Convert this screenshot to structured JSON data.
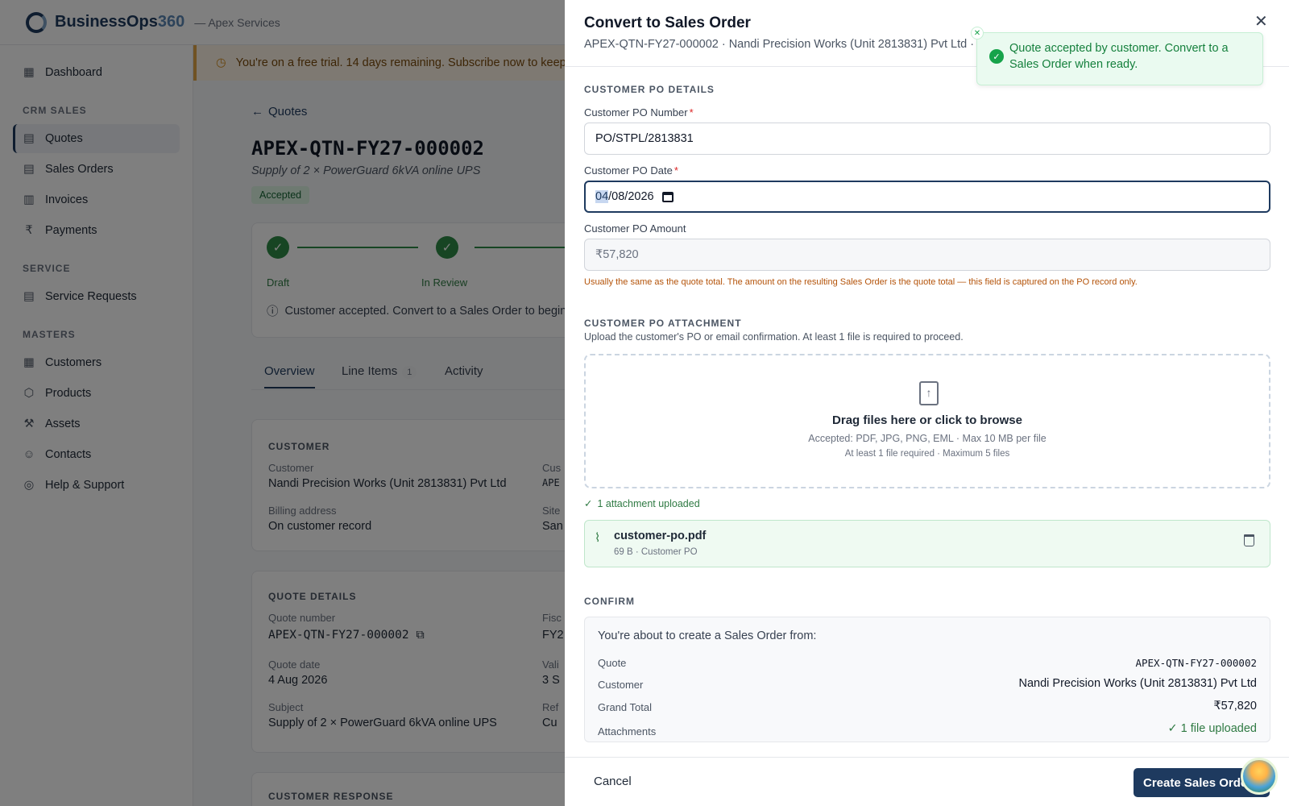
{
  "app": {
    "brand_main": "BusinessOps",
    "brand_accent": "360",
    "org": "— Apex Services"
  },
  "sidebar": {
    "items": [
      {
        "label": "Dashboard",
        "icon": "grid-icon"
      },
      {
        "section": "CRM SALES"
      },
      {
        "label": "Quotes",
        "icon": "document-icon",
        "active": true
      },
      {
        "label": "Sales Orders",
        "icon": "document-icon"
      },
      {
        "label": "Invoices",
        "icon": "receipt-icon"
      },
      {
        "label": "Payments",
        "icon": "rupee-icon"
      },
      {
        "section": "SERVICE"
      },
      {
        "label": "Service Requests",
        "icon": "clipboard-icon"
      },
      {
        "section": "MASTERS"
      },
      {
        "label": "Customers",
        "icon": "building-icon"
      },
      {
        "label": "Products",
        "icon": "box-icon"
      },
      {
        "label": "Assets",
        "icon": "wrench-icon"
      },
      {
        "label": "Contacts",
        "icon": "user-icon"
      },
      {
        "label": "Help & Support",
        "icon": "lifebuoy-icon"
      }
    ]
  },
  "trial": {
    "text": "You're on a free trial. 14 days remaining. Subscribe now to keep"
  },
  "quote": {
    "back": "Quotes",
    "number": "APEX-QTN-FY27-000002",
    "subject": "Supply of 2 × PowerGuard 6kVA online UPS",
    "status": "Accepted",
    "steps": [
      "Draft",
      "In Review"
    ],
    "info": "Customer accepted. Convert to a Sales Order to begin",
    "tabs": {
      "overview": "Overview",
      "line_items": "Line Items",
      "line_items_count": "1",
      "activity": "Activity"
    },
    "customer_card": {
      "title": "CUSTOMER",
      "customer_label": "Customer",
      "customer_value": "Nandi Precision Works (Unit 2813831) Pvt Ltd",
      "billing_label": "Billing address",
      "billing_value": "On customer record",
      "col2_label_1": "Cus",
      "col2_value_1": "APE",
      "col2_label_2": "Site",
      "col2_value_2": "San"
    },
    "details_card": {
      "title": "QUOTE DETAILS",
      "number_label": "Quote number",
      "number_value": "APEX-QTN-FY27-000002",
      "date_label": "Quote date",
      "date_value": "4 Aug 2026",
      "subject_label": "Subject",
      "subject_value": "Supply of 2 × PowerGuard 6kVA online UPS",
      "col2_label_1": "Fisc",
      "col2_value_1": "FY2",
      "col2_label_2": "Vali",
      "col2_value_2": "3 S",
      "col2_label_3": "Ref",
      "col2_value_3": "Cu"
    },
    "response_title": "CUSTOMER RESPONSE"
  },
  "drawer": {
    "title": "Convert to Sales Order",
    "subtitle": "APEX-QTN-FY27-000002 · Nandi Precision Works (Unit 2813831) Pvt Ltd ·",
    "po_section": "CUSTOMER PO DETAILS",
    "po_number_label": "Customer PO Number",
    "po_number_value": "PO/STPL/2813831",
    "po_date_label": "Customer PO Date",
    "po_date_month": "04",
    "po_date_rest": "/08/2026",
    "po_amount_label": "Customer PO Amount",
    "po_amount_placeholder": "₹57,820",
    "po_amount_hint": "Usually the same as the quote total. The amount on the resulting Sales Order is the quote total — this field is captured on the PO record only.",
    "attach_section": "CUSTOMER PO ATTACHMENT",
    "attach_desc": "Upload the customer's PO or email confirmation. At least 1 file is required to proceed.",
    "dropzone_main": "Drag files here or click to browse",
    "dropzone_accepted": "Accepted: PDF, JPG, PNG, EML · Max 10 MB per file",
    "dropzone_limits": "At least 1 file required · Maximum 5 files",
    "uploaded_status": "1 attachment uploaded",
    "file_name": "customer-po.pdf",
    "file_meta": "69 B · Customer PO",
    "confirm_section": "CONFIRM",
    "confirm_intro": "You're about to create a Sales Order from:",
    "confirm_rows": [
      {
        "key": "Quote",
        "value": "APEX-QTN-FY27-000002"
      },
      {
        "key": "Customer",
        "value": "Nandi Precision Works (Unit 2813831) Pvt Ltd"
      },
      {
        "key": "Grand Total",
        "value": "₹57,820"
      },
      {
        "key": "Attachments",
        "value": "1 file uploaded"
      }
    ],
    "cancel": "Cancel",
    "submit": "Create Sales Order"
  },
  "toast": {
    "text": "Quote accepted by customer. Convert to a Sales Order when ready."
  },
  "colors": {
    "brand": "#1e3a5f",
    "success": "#2f8a47",
    "warning": "#b45309",
    "overlay": "rgba(0,0,0,0.5)"
  }
}
